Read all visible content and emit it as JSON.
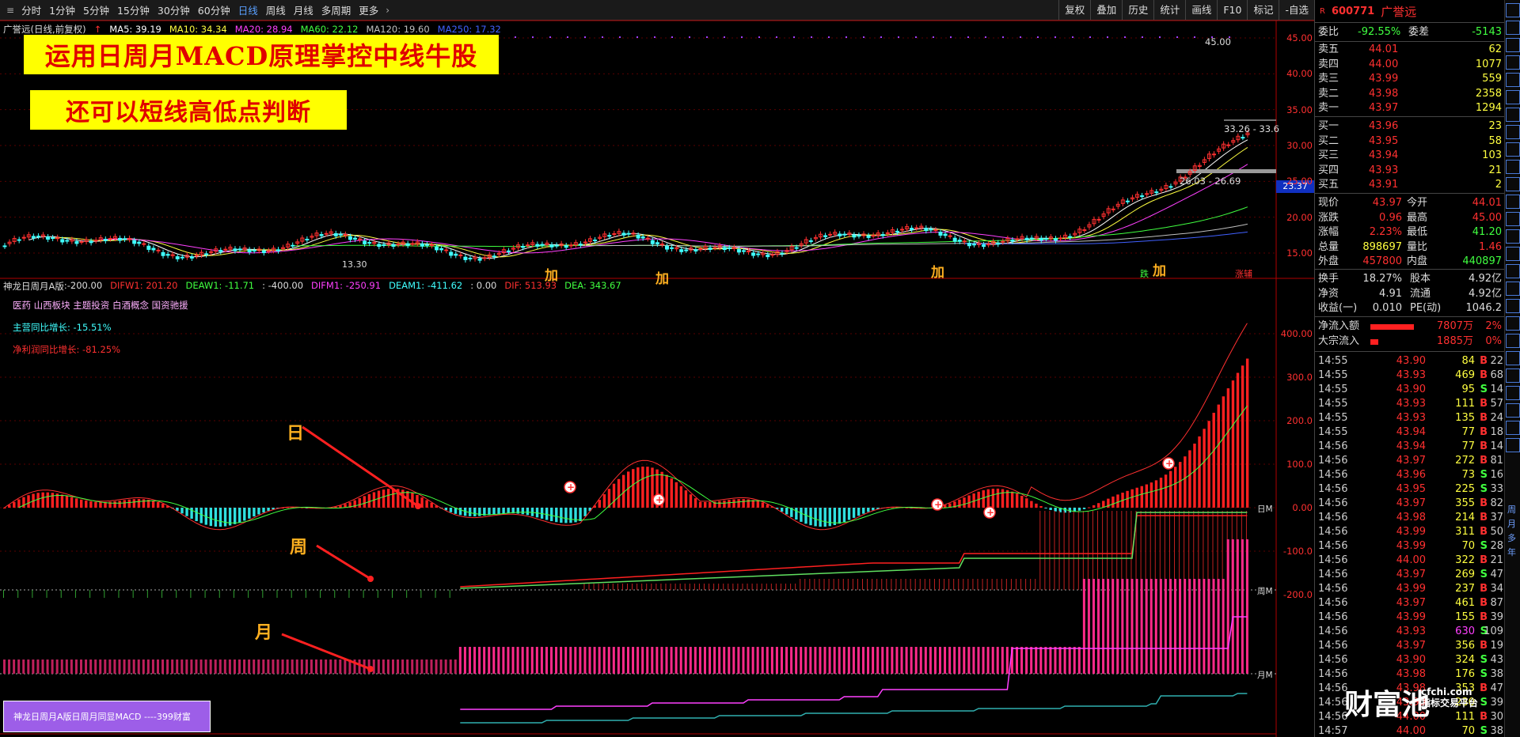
{
  "toolbar": {
    "periods": [
      "分时",
      "1分钟",
      "5分钟",
      "15分钟",
      "30分钟",
      "60分钟",
      "日线",
      "周线",
      "月线",
      "多周期",
      "更多"
    ],
    "active_period": "日线",
    "tools": [
      "复权",
      "叠加",
      "历史",
      "统计",
      "画线",
      "F10",
      "标记",
      "-自选"
    ]
  },
  "legend": {
    "stock": "广誉远(日线,前复权)",
    "ma5": "MA5: 39.19",
    "ma10": "MA10: 34.34",
    "ma20": "MA20: 28.94",
    "ma60": "MA60: 22.12",
    "ma120": "MA120: 19.60",
    "ma250": "MA250: 17.32"
  },
  "banners": {
    "b1": "运用日周月MACD原理掌控中线牛股",
    "b2": "还可以短线高低点判断"
  },
  "price_labels": {
    "high": "45.00",
    "mid": "33.26 - 33.6",
    "lower": "26.03 - 26.69",
    "low": "13.30",
    "current_box": "23.37"
  },
  "price_axis": [
    "45.00",
    "40.00",
    "35.00",
    "30.00",
    "25.00",
    "20.00",
    "15.00"
  ],
  "annotations": {
    "jia": [
      "加",
      "加",
      "加",
      "加"
    ],
    "die": "跌",
    "zhang": "涨辅"
  },
  "indicator_legend": {
    "name": "神龙日周月A版",
    "value": ":-200.00",
    "difw1": "DIFW1: 201.20",
    "deaw1": "DEAW1: -11.71",
    "val2": ": -400.00",
    "difm1": "DIFM1: -250.91",
    "deam1": "DEAM1: -411.62",
    "val3": ": 0.00",
    "dif": "DIF: 513.93",
    "dea": "DEA: 343.67"
  },
  "info": {
    "concepts": "医药 山西板块 主题投资 白酒概念 国资驰援",
    "revenue": "主营同比增长: -15.51%",
    "profit": "净利润同比增长: -81.25%"
  },
  "indicator_axis": [
    "400.00",
    "300.0",
    "200.0",
    "100.0",
    "0.00",
    "-100.0",
    "-200.0"
  ],
  "line_labels": {
    "day": "日M",
    "week": "周M",
    "month": "月M"
  },
  "markers": {
    "day": "日",
    "week": "周",
    "month": "月"
  },
  "promo": "神龙日周月A版日周月同显MACD ----399财富",
  "quote": {
    "r": "R",
    "code": "600771",
    "name": "广誉远",
    "weibi_label": "委比",
    "weibi": "-92.55%",
    "weicha_label": "委差",
    "weicha": "-5143",
    "asks": [
      {
        "label": "卖五",
        "price": "44.01",
        "vol": "62"
      },
      {
        "label": "卖四",
        "price": "44.00",
        "vol": "1077"
      },
      {
        "label": "卖三",
        "price": "43.99",
        "vol": "559"
      },
      {
        "label": "卖二",
        "price": "43.98",
        "vol": "2358"
      },
      {
        "label": "卖一",
        "price": "43.97",
        "vol": "1294"
      }
    ],
    "bids": [
      {
        "label": "买一",
        "price": "43.96",
        "vol": "23"
      },
      {
        "label": "买二",
        "price": "43.95",
        "vol": "58"
      },
      {
        "label": "买三",
        "price": "43.94",
        "vol": "103"
      },
      {
        "label": "买四",
        "price": "43.93",
        "vol": "21"
      },
      {
        "label": "买五",
        "price": "43.91",
        "vol": "2"
      }
    ],
    "stats": [
      {
        "l1": "现价",
        "v1": "43.97",
        "l2": "今开",
        "v2": "44.01",
        "c1": "#ff3030",
        "c2": "#ff3030"
      },
      {
        "l1": "涨跌",
        "v1": "0.96",
        "l2": "最高",
        "v2": "45.00",
        "c1": "#ff3030",
        "c2": "#ff3030"
      },
      {
        "l1": "涨幅",
        "v1": "2.23%",
        "l2": "最低",
        "v2": "41.20",
        "c1": "#ff3030",
        "c2": "#40ff40"
      },
      {
        "l1": "总量",
        "v1": "898697",
        "l2": "量比",
        "v2": "1.46",
        "c1": "#ffff40",
        "c2": "#ff3030"
      },
      {
        "l1": "外盘",
        "v1": "457800",
        "l2": "内盘",
        "v2": "440897",
        "c1": "#ff3030",
        "c2": "#40ff40"
      }
    ],
    "stats2": [
      {
        "l1": "换手",
        "v1": "18.27%",
        "l2": "股本",
        "v2": "4.92亿"
      },
      {
        "l1": "净资",
        "v1": "4.91",
        "l2": "流通",
        "v2": "4.92亿"
      },
      {
        "l1": "收益(一)",
        "v1": "0.010",
        "l2": "PE(动)",
        "v2": "1046.2"
      }
    ],
    "flows": [
      {
        "label": "净流入额",
        "value": "7807万",
        "pct": "2%",
        "fill": 0.55
      },
      {
        "label": "大宗流入",
        "value": "1885万",
        "pct": "0%",
        "fill": 0.1
      }
    ]
  },
  "ticks": [
    {
      "t": "14:55",
      "p": "43.90",
      "v": "84",
      "s": "B",
      "n": "22"
    },
    {
      "t": "14:55",
      "p": "43.93",
      "v": "469",
      "s": "B",
      "n": "68"
    },
    {
      "t": "14:55",
      "p": "43.90",
      "v": "95",
      "s": "S",
      "n": "14"
    },
    {
      "t": "14:55",
      "p": "43.93",
      "v": "111",
      "s": "B",
      "n": "57"
    },
    {
      "t": "14:55",
      "p": "43.93",
      "v": "135",
      "s": "B",
      "n": "24"
    },
    {
      "t": "14:55",
      "p": "43.94",
      "v": "77",
      "s": "B",
      "n": "18"
    },
    {
      "t": "14:56",
      "p": "43.94",
      "v": "77",
      "s": "B",
      "n": "14"
    },
    {
      "t": "14:56",
      "p": "43.97",
      "v": "272",
      "s": "B",
      "n": "81"
    },
    {
      "t": "14:56",
      "p": "43.96",
      "v": "73",
      "s": "S",
      "n": "16"
    },
    {
      "t": "14:56",
      "p": "43.95",
      "v": "225",
      "s": "S",
      "n": "33"
    },
    {
      "t": "14:56",
      "p": "43.97",
      "v": "355",
      "s": "B",
      "n": "82"
    },
    {
      "t": "14:56",
      "p": "43.98",
      "v": "214",
      "s": "B",
      "n": "37"
    },
    {
      "t": "14:56",
      "p": "43.99",
      "v": "311",
      "s": "B",
      "n": "50"
    },
    {
      "t": "14:56",
      "p": "43.99",
      "v": "70",
      "s": "S",
      "n": "28"
    },
    {
      "t": "14:56",
      "p": "44.00",
      "v": "322",
      "s": "B",
      "n": "21"
    },
    {
      "t": "14:56",
      "p": "43.97",
      "v": "269",
      "s": "S",
      "n": "47"
    },
    {
      "t": "14:56",
      "p": "43.99",
      "v": "237",
      "s": "B",
      "n": "34"
    },
    {
      "t": "14:56",
      "p": "43.97",
      "v": "461",
      "s": "B",
      "n": "87"
    },
    {
      "t": "14:56",
      "p": "43.99",
      "v": "155",
      "s": "B",
      "n": "39"
    },
    {
      "t": "14:56",
      "p": "43.93",
      "v": "630",
      "s": "S",
      "n": "109"
    },
    {
      "t": "14:56",
      "p": "43.97",
      "v": "356",
      "s": "B",
      "n": "19"
    },
    {
      "t": "14:56",
      "p": "43.90",
      "v": "324",
      "s": "S",
      "n": "43"
    },
    {
      "t": "14:56",
      "p": "43.98",
      "v": "176",
      "s": "S",
      "n": "38"
    },
    {
      "t": "14:56",
      "p": "43.98",
      "v": "353",
      "s": "B",
      "n": "47"
    },
    {
      "t": "14:56",
      "p": "43.90",
      "v": "230",
      "s": "S",
      "n": "39"
    },
    {
      "t": "14:56",
      "p": "44.00",
      "v": "111",
      "s": "B",
      "n": "30"
    },
    {
      "t": "14:57",
      "p": "44.00",
      "v": "70",
      "s": "S",
      "n": "38"
    }
  ],
  "watermark": {
    "big": "财富池",
    "url": "cfchi.com",
    "sub": "指标交易平台"
  },
  "side_icons": [
    "周",
    "月",
    "多",
    "年"
  ]
}
